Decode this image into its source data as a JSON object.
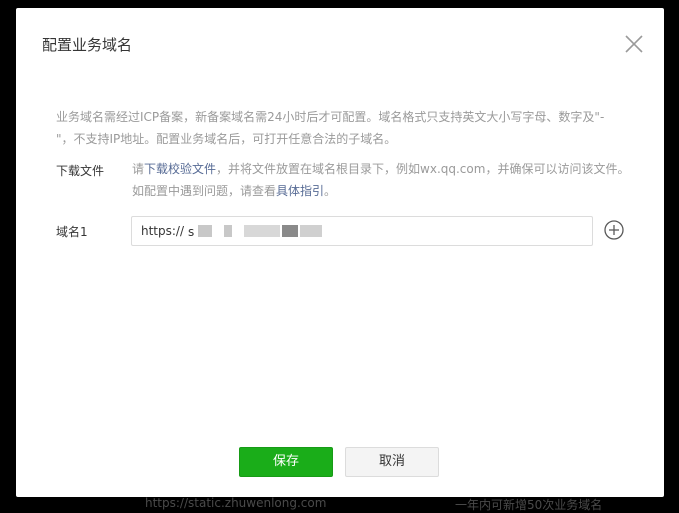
{
  "dialog": {
    "title": "配置业务域名",
    "description": "业务域名需经过ICP备案，新备案域名需24小时后才可配置。域名格式只支持英文大小写字母、数字及\"- \"，不支持IP地址。配置业务域名后，可打开任意合法的子域名。",
    "download": {
      "label": "下载文件",
      "prefix": "请",
      "link_file": "下载校验文件",
      "middle": "，并将文件放置在域名根目录下，例如wx.qq.com，并确保可以访问该文件。如配置中遇到问题，请查看",
      "link_guide": "具体指引",
      "suffix": "。"
    },
    "domain": {
      "label": "域名1",
      "prefix": "https://",
      "value": "s"
    },
    "save_label": "保存",
    "cancel_label": "取消"
  },
  "background": {
    "left_text": "https://static.zhuwenlong.com",
    "right_text": "一年内可新增50次业务域名"
  },
  "colors": {
    "primary_green": "#1aad19",
    "link_blue": "#576b95"
  },
  "icons": {
    "close": "close-icon",
    "add": "plus-circle-icon"
  }
}
